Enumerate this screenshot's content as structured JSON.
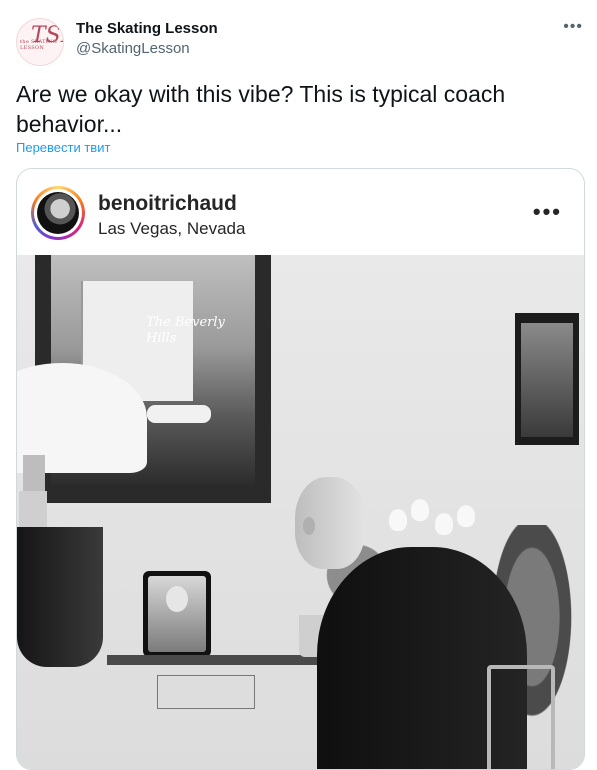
{
  "tweet": {
    "author": {
      "display_name": "The Skating Lesson",
      "handle": "@SkatingLesson",
      "avatar_text": "TSL",
      "avatar_tagline": "the SKATING LESSON"
    },
    "more_icon": "•••",
    "text": "Are we okay with this vibe? This is typical coach behavior...",
    "translate_link": "Перевести твит"
  },
  "instagram_post": {
    "username": "benoitrichaud",
    "location": "Las Vegas, Nevada",
    "more_icon": "•••",
    "poster_sign": "The Beverly Hills"
  },
  "colors": {
    "link_blue": "#1d9bf0",
    "secondary_text": "#536471",
    "brand_pink": "#b5475a"
  }
}
